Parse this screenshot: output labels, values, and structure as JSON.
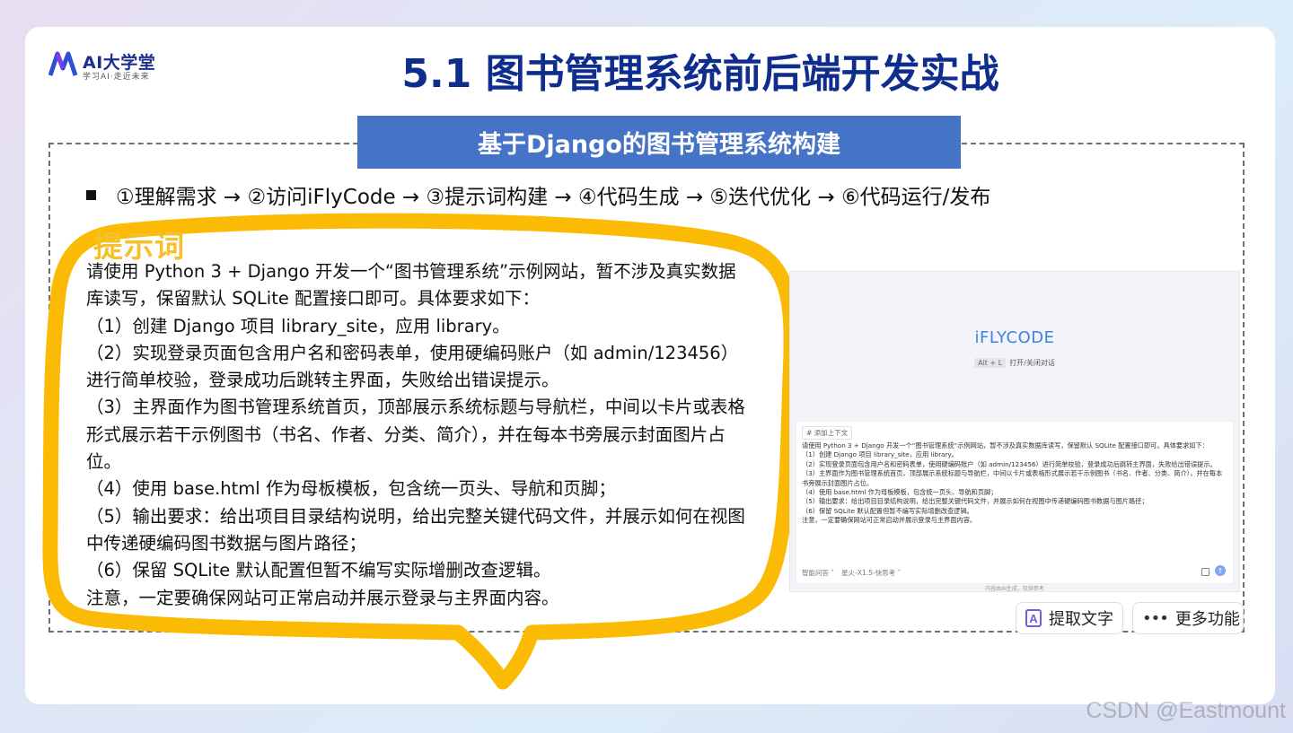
{
  "brand": {
    "logo_text": "AI大学堂",
    "logo_subtitle": "学习AI·走近未来"
  },
  "slide": {
    "title": "5.1 图书管理系统前后端开发实战",
    "subtitle": "基于Django的图书管理系统构建",
    "steps": "①理解需求 → ②访问iFlyCode → ③提示词构建 → ④代码生成 → ⑤迭代优化 → ⑥代码运行/发布"
  },
  "prompt": {
    "heading": "提示词",
    "lines": [
      "请使用 Python 3 + Django 开发一个“图书管理系统”示例网站，暂不涉及真实数据库读写，保留默认 SQLite 配置接口即可。具体要求如下：",
      "（1）创建 Django 项目 library_site，应用 library。",
      "（2）实现登录页面包含用户名和密码表单，使用硬编码账户（如 admin/123456）进行简单校验，登录成功后跳转主界面，失败给出错误提示。",
      "（3）主界面作为图书管理系统首页，顶部展示系统标题与导航栏，中间以卡片或表格形式展示若干示例图书（书名、作者、分类、简介），并在每本书旁展示封面图片占位。",
      "（4）使用 base.html 作为母板模板，包含统一页头、导航和页脚；",
      "（5）输出要求：给出项目目录结构说明，给出完整关键代码文件，并展示如何在视图中传递硬编码图书数据与图片路径；",
      "（6）保留 SQLite 默认配置但暂不编写实际增删改查逻辑。",
      "注意，一定要确保网站可正常启动并展示登录与主界面内容。"
    ]
  },
  "app": {
    "brand": "iFLYCODE",
    "shortcut_key": "Alt + L",
    "shortcut_label": "打开/关闭对话",
    "context_chip": "# 添加上下文",
    "chat_lines": [
      "请使用 Python 3 + Django 开发一个“图书管理系统”示例网站，暂不涉及真实数据库读写，保留默认 SQLite 配置接口即可。具体要求如下：",
      "（1）创建 Django 项目 library_site，应用 library。",
      "（2）实现登录页面包含用户名和密码表单，使用硬编码账户（如 admin/123456）进行简单校验，登录成功后跳转主界面，失败给出错误提示。",
      "（3）主界面作为图书管理系统首页，顶部展示系统标题与导航栏，中间以卡片或表格形式展示若干示例图书（书名、作者、分类、简介），并在每本书旁展示封面图片占位。",
      "（4）使用 base.html 作为母板模板，包含统一页头、导航和页脚；",
      "（5）输出要求：给出项目目录结构说明，给出完整关键代码文件，并展示如何在视图中传递硬编码图书数据与图片路径；",
      "（6）保留 SQLite 默认配置但暂不编写实际增删改查逻辑。",
      "注意，一定要确保网站可正常启动并展示登录与主界面内容。"
    ],
    "mode_select": "智能问答 ˅",
    "model_select": "星火-X1.5-快思考 ˅",
    "disclaimer": "内容由AI生成，仅供参考"
  },
  "actions": {
    "extract_text": "提取文字",
    "more": "更多功能"
  },
  "watermark": "CSDN @Eastmount",
  "colors": {
    "title": "#0f2d8c",
    "band": "#4573c6",
    "bubble": "#fbbb05",
    "iflycode": "#3f7fe8"
  }
}
